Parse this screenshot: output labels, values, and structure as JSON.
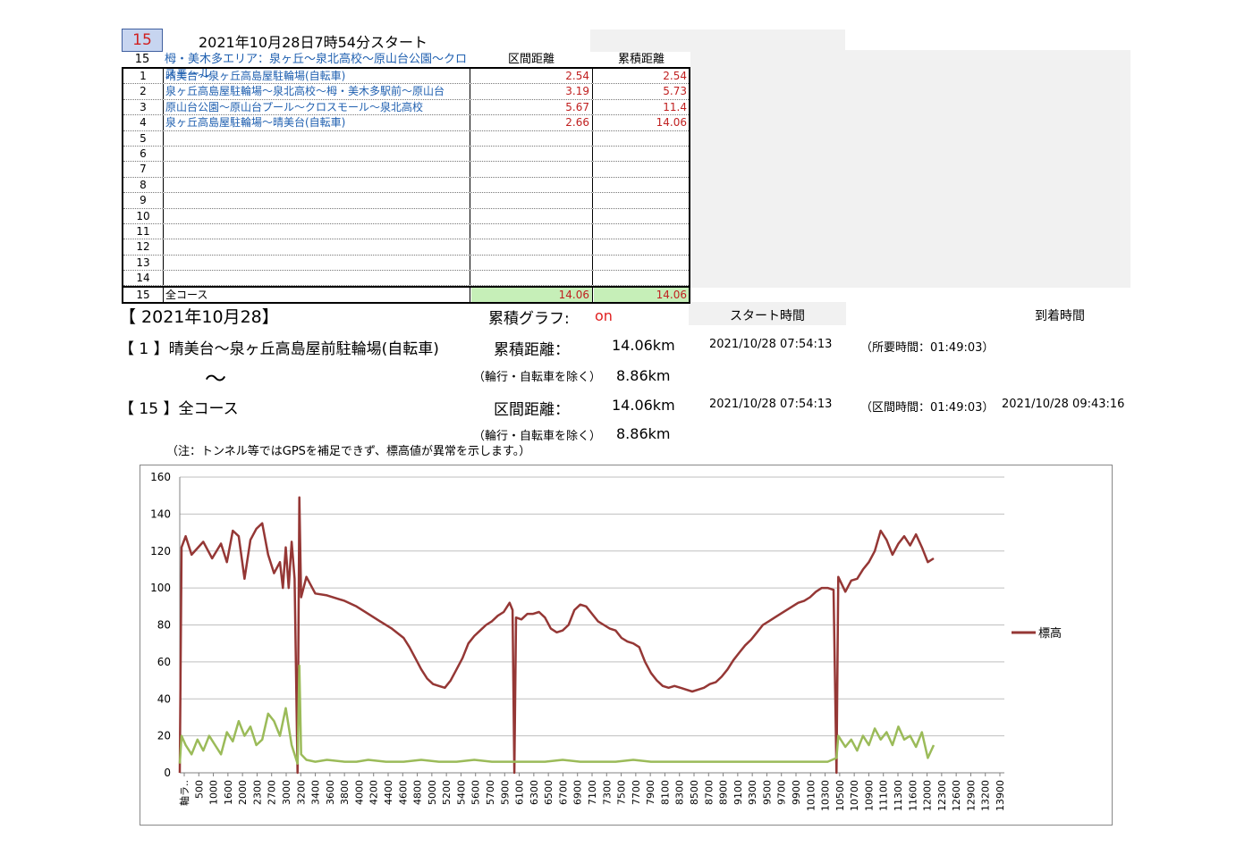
{
  "header": {
    "id_badge": "15",
    "start_title": "2021年10月28日7時54分スタート",
    "area_num": "15",
    "area_name": "栂・美木多エリア：泉ヶ丘～泉北高校～原山台公園～クロスモール",
    "col_section": "区間距離",
    "col_cumulative": "累積距離"
  },
  "table": {
    "rows": [
      {
        "num": "1",
        "name": "晴美台～泉ヶ丘高島屋駐輪場(自転車)",
        "section": "2.54",
        "cumulative": "2.54"
      },
      {
        "num": "2",
        "name": "泉ヶ丘高島屋駐輪場～泉北高校～栂・美木多駅前～原山台",
        "section": "3.19",
        "cumulative": "5.73"
      },
      {
        "num": "3",
        "name": "原山台公園～原山台プール～クロスモール～泉北高校",
        "section": "5.67",
        "cumulative": "11.4"
      },
      {
        "num": "4",
        "name": "泉ヶ丘高島屋駐輪場～晴美台(自転車)",
        "section": "2.66",
        "cumulative": "14.06"
      },
      {
        "num": "5",
        "name": "",
        "section": "",
        "cumulative": ""
      },
      {
        "num": "6",
        "name": "",
        "section": "",
        "cumulative": ""
      },
      {
        "num": "7",
        "name": "",
        "section": "",
        "cumulative": ""
      },
      {
        "num": "8",
        "name": "",
        "section": "",
        "cumulative": ""
      },
      {
        "num": "9",
        "name": "",
        "section": "",
        "cumulative": ""
      },
      {
        "num": "10",
        "name": "",
        "section": "",
        "cumulative": ""
      },
      {
        "num": "11",
        "name": "",
        "section": "",
        "cumulative": ""
      },
      {
        "num": "12",
        "name": "",
        "section": "",
        "cumulative": ""
      },
      {
        "num": "13",
        "name": "",
        "section": "",
        "cumulative": ""
      },
      {
        "num": "14",
        "name": "",
        "section": "",
        "cumulative": ""
      }
    ],
    "total": {
      "num": "15",
      "name": "全コース",
      "section": "14.06",
      "cumulative": "14.06"
    }
  },
  "summary": {
    "date": "【 2021年10月28】",
    "graph_label": "累積グラフ:",
    "graph_value": "on",
    "start_time_header": "スタート時間",
    "arrival_time_header": "到着時間",
    "from_label": "【 1 】晴美台～泉ヶ丘高島屋前駐輪場(自転車)",
    "tilde": "～",
    "to_label": "【 15 】全コース",
    "cum_label": "累積距離：",
    "cum_value": "14.06km",
    "sec_label": "区間距離：",
    "sec_value": "14.06km",
    "exclude_label": "（輪行・自転車を除く）",
    "exclude_value_1": "8.86km",
    "exclude_value_2": "8.86km",
    "start_1": "2021/10/28 07:54:13",
    "duration_1": "（所要時間：01:49:03）",
    "start_2": "2021/10/28 07:54:13",
    "duration_2": "（区間時間：01:49:03）",
    "arrival_2": "2021/10/28 09:43:16",
    "note": "（注：トンネル等ではGPSを補足できず、標高値が異常を示します。）"
  },
  "colors": {
    "elevation_line": "#953735",
    "secondary_line": "#9bbb59",
    "grid": "#bfbfbf"
  },
  "chart_data": {
    "type": "line",
    "ylim": [
      0,
      160
    ],
    "yticks": [
      0,
      20,
      40,
      60,
      80,
      100,
      120,
      140,
      160
    ],
    "xlim": [
      0,
      14000
    ],
    "xtick_labels": [
      "軸ラ..",
      "500",
      "1000",
      "1600",
      "2000",
      "2300",
      "2700",
      "3000",
      "3200",
      "3400",
      "3600",
      "3800",
      "4000",
      "4200",
      "4400",
      "4600",
      "4800",
      "5000",
      "5200",
      "5400",
      "5600",
      "5700",
      "5900",
      "6100",
      "6300",
      "6500",
      "6700",
      "6900",
      "7100",
      "7300",
      "7500",
      "7700",
      "7900",
      "8100",
      "8300",
      "8500",
      "8700",
      "8900",
      "9100",
      "9300",
      "9500",
      "9700",
      "9900",
      "10100",
      "10300",
      "10500",
      "10700",
      "10900",
      "11100",
      "11300",
      "11600",
      "12000",
      "12300",
      "12600",
      "12900",
      "13200",
      "13900"
    ],
    "legend": "標高",
    "legend_position": "right",
    "grid": true,
    "series": [
      {
        "name": "標高",
        "color": "#953735",
        "points": [
          [
            0,
            0
          ],
          [
            30,
            122
          ],
          [
            100,
            128
          ],
          [
            200,
            118
          ],
          [
            400,
            125
          ],
          [
            550,
            116
          ],
          [
            700,
            124
          ],
          [
            800,
            114
          ],
          [
            900,
            131
          ],
          [
            1000,
            128
          ],
          [
            1100,
            105
          ],
          [
            1200,
            126
          ],
          [
            1300,
            132
          ],
          [
            1400,
            135
          ],
          [
            1500,
            118
          ],
          [
            1600,
            108
          ],
          [
            1700,
            114
          ],
          [
            1750,
            100
          ],
          [
            1800,
            122
          ],
          [
            1850,
            100
          ],
          [
            1900,
            125
          ],
          [
            1950,
            105
          ],
          [
            2000,
            0
          ],
          [
            2030,
            149
          ],
          [
            2060,
            95
          ],
          [
            2150,
            106
          ],
          [
            2300,
            97
          ],
          [
            2500,
            96
          ],
          [
            2800,
            93
          ],
          [
            3000,
            90
          ],
          [
            3200,
            86
          ],
          [
            3400,
            82
          ],
          [
            3600,
            78
          ],
          [
            3800,
            73
          ],
          [
            3900,
            68
          ],
          [
            4000,
            62
          ],
          [
            4100,
            56
          ],
          [
            4200,
            51
          ],
          [
            4300,
            48
          ],
          [
            4400,
            47
          ],
          [
            4500,
            46
          ],
          [
            4600,
            50
          ],
          [
            4700,
            56
          ],
          [
            4800,
            62
          ],
          [
            4900,
            70
          ],
          [
            5000,
            74
          ],
          [
            5100,
            77
          ],
          [
            5200,
            80
          ],
          [
            5300,
            82
          ],
          [
            5400,
            85
          ],
          [
            5500,
            87
          ],
          [
            5600,
            92
          ],
          [
            5650,
            88
          ],
          [
            5680,
            0
          ],
          [
            5710,
            84
          ],
          [
            5800,
            83
          ],
          [
            5900,
            86
          ],
          [
            6000,
            86
          ],
          [
            6100,
            87
          ],
          [
            6200,
            84
          ],
          [
            6300,
            78
          ],
          [
            6400,
            76
          ],
          [
            6500,
            77
          ],
          [
            6600,
            80
          ],
          [
            6700,
            88
          ],
          [
            6800,
            91
          ],
          [
            6900,
            90
          ],
          [
            7000,
            86
          ],
          [
            7100,
            82
          ],
          [
            7200,
            80
          ],
          [
            7300,
            78
          ],
          [
            7400,
            77
          ],
          [
            7500,
            73
          ],
          [
            7600,
            71
          ],
          [
            7700,
            70
          ],
          [
            7800,
            68
          ],
          [
            7900,
            60
          ],
          [
            8000,
            54
          ],
          [
            8100,
            50
          ],
          [
            8200,
            47
          ],
          [
            8300,
            46
          ],
          [
            8400,
            47
          ],
          [
            8500,
            46
          ],
          [
            8600,
            45
          ],
          [
            8700,
            44
          ],
          [
            8800,
            45
          ],
          [
            8900,
            46
          ],
          [
            9000,
            48
          ],
          [
            9100,
            49
          ],
          [
            9200,
            52
          ],
          [
            9300,
            56
          ],
          [
            9400,
            61
          ],
          [
            9500,
            65
          ],
          [
            9600,
            69
          ],
          [
            9700,
            72
          ],
          [
            9800,
            76
          ],
          [
            9900,
            80
          ],
          [
            10000,
            82
          ],
          [
            10100,
            84
          ],
          [
            10200,
            86
          ],
          [
            10300,
            88
          ],
          [
            10400,
            90
          ],
          [
            10500,
            92
          ],
          [
            10600,
            93
          ],
          [
            10700,
            95
          ],
          [
            10800,
            98
          ],
          [
            10900,
            100
          ],
          [
            11000,
            100
          ],
          [
            11100,
            99
          ],
          [
            11150,
            0
          ],
          [
            11180,
            106
          ],
          [
            11300,
            98
          ],
          [
            11400,
            104
          ],
          [
            11500,
            105
          ],
          [
            11600,
            110
          ],
          [
            11700,
            114
          ],
          [
            11800,
            120
          ],
          [
            11900,
            131
          ],
          [
            12000,
            126
          ],
          [
            12100,
            118
          ],
          [
            12200,
            124
          ],
          [
            12300,
            128
          ],
          [
            12400,
            123
          ],
          [
            12500,
            129
          ],
          [
            12600,
            122
          ],
          [
            12700,
            114
          ],
          [
            12800,
            116
          ]
        ]
      },
      {
        "name": "",
        "color": "#9bbb59",
        "points": [
          [
            0,
            5
          ],
          [
            30,
            20
          ],
          [
            100,
            15
          ],
          [
            200,
            10
          ],
          [
            300,
            18
          ],
          [
            400,
            12
          ],
          [
            500,
            20
          ],
          [
            600,
            15
          ],
          [
            700,
            10
          ],
          [
            800,
            22
          ],
          [
            900,
            17
          ],
          [
            1000,
            28
          ],
          [
            1100,
            20
          ],
          [
            1200,
            25
          ],
          [
            1300,
            15
          ],
          [
            1400,
            18
          ],
          [
            1500,
            32
          ],
          [
            1600,
            28
          ],
          [
            1700,
            20
          ],
          [
            1800,
            35
          ],
          [
            1900,
            15
          ],
          [
            2000,
            5
          ],
          [
            2030,
            58
          ],
          [
            2060,
            10
          ],
          [
            2150,
            7
          ],
          [
            2300,
            6
          ],
          [
            2500,
            7
          ],
          [
            2800,
            6
          ],
          [
            3000,
            6
          ],
          [
            3200,
            7
          ],
          [
            3500,
            6
          ],
          [
            3800,
            6
          ],
          [
            4100,
            7
          ],
          [
            4400,
            6
          ],
          [
            4700,
            6
          ],
          [
            5000,
            7
          ],
          [
            5300,
            6
          ],
          [
            5600,
            6
          ],
          [
            5900,
            6
          ],
          [
            6200,
            6
          ],
          [
            6500,
            7
          ],
          [
            6800,
            6
          ],
          [
            7100,
            6
          ],
          [
            7400,
            6
          ],
          [
            7700,
            7
          ],
          [
            8000,
            6
          ],
          [
            8300,
            6
          ],
          [
            8600,
            6
          ],
          [
            8900,
            6
          ],
          [
            9200,
            6
          ],
          [
            9500,
            6
          ],
          [
            9800,
            6
          ],
          [
            10100,
            6
          ],
          [
            10400,
            6
          ],
          [
            10700,
            6
          ],
          [
            11000,
            6
          ],
          [
            11150,
            8
          ],
          [
            11180,
            20
          ],
          [
            11300,
            14
          ],
          [
            11400,
            18
          ],
          [
            11500,
            12
          ],
          [
            11600,
            20
          ],
          [
            11700,
            15
          ],
          [
            11800,
            24
          ],
          [
            11900,
            18
          ],
          [
            12000,
            22
          ],
          [
            12100,
            15
          ],
          [
            12200,
            25
          ],
          [
            12300,
            18
          ],
          [
            12400,
            20
          ],
          [
            12500,
            14
          ],
          [
            12600,
            22
          ],
          [
            12700,
            8
          ],
          [
            12800,
            15
          ]
        ]
      }
    ]
  }
}
